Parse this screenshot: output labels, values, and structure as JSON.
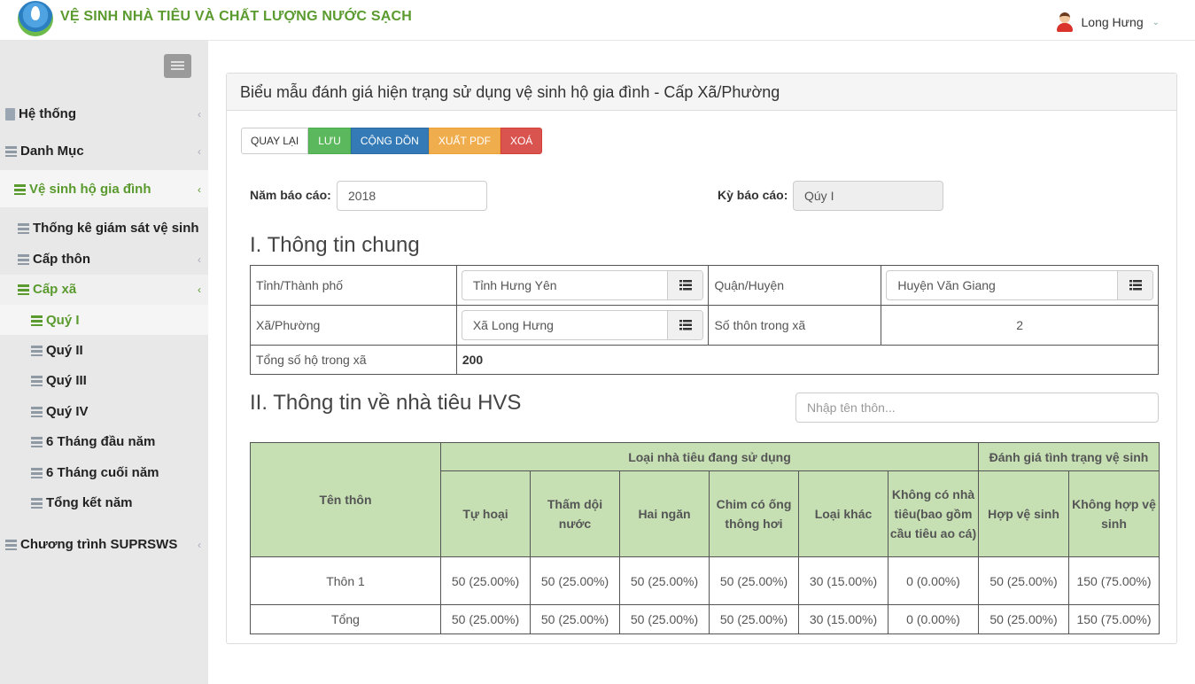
{
  "header": {
    "app_title": "VỆ SINH NHÀ TIÊU VÀ CHẤT LƯỢNG NƯỚC SẠCH",
    "user_name": "Long Hưng"
  },
  "sidebar": {
    "items": [
      {
        "label": "Hệ thống"
      },
      {
        "label": "Danh Mục"
      },
      {
        "label": "Vệ sinh hộ gia đình"
      },
      {
        "label": "Thống kê giám sát vệ sinh"
      },
      {
        "label": "Cấp thôn"
      },
      {
        "label": "Cấp xã"
      },
      {
        "label": "Quý I"
      },
      {
        "label": "Quý II"
      },
      {
        "label": "Quý III"
      },
      {
        "label": "Quý IV"
      },
      {
        "label": "6 Tháng đầu năm"
      },
      {
        "label": "6 Tháng cuối năm"
      },
      {
        "label": "Tổng kết năm"
      },
      {
        "label": "Chương trình SUPRSWS"
      }
    ]
  },
  "panel": {
    "title": "Biểu mẫu đánh giá hiện trạng sử dụng vệ sinh hộ gia đình - Cấp Xã/Phường",
    "buttons": {
      "back": "QUAY LẠI",
      "save": "LƯU",
      "accumulate": "CỘNG DỒN",
      "export_pdf": "XUẤT PDF",
      "delete": "XOÁ"
    },
    "year_label": "Năm báo cáo:",
    "year_value": "2018",
    "period_label": "Kỳ báo cáo:",
    "period_value": "Qúy I",
    "section1_title": "I. Thông tin chung",
    "info": {
      "province_label": "Tỉnh/Thành phố",
      "province_value": "Tỉnh Hưng Yên",
      "district_label": "Quận/Huyện",
      "district_value": "Huyện Văn Giang",
      "commune_label": "Xã/Phường",
      "commune_value": "Xã Long Hưng",
      "villages_label": "Số thôn trong xã",
      "villages_value": "2",
      "households_label": "Tổng số hộ trong xã",
      "households_value": "200"
    },
    "section2_title": "II. Thông tin về nhà tiêu HVS",
    "search_placeholder": "Nhập tên thôn...",
    "table": {
      "col_village": "Tên thôn",
      "group_types": "Loại nhà tiêu đang sử dụng",
      "group_eval": "Đánh giá tình trạng vệ sinh",
      "cols": [
        "Tự hoại",
        "Thấm dội nước",
        "Hai ngăn",
        "Chim có ống thông hơi",
        "Loại khác",
        "Không có nhà tiêu(bao gồm cầu tiêu ao cá)",
        "Hợp vệ sinh",
        "Không hợp vệ sinh"
      ],
      "rows": [
        {
          "name": "Thôn 1",
          "values": [
            "50 (25.00%)",
            "50 (25.00%)",
            "50 (25.00%)",
            "50 (25.00%)",
            "30 (15.00%)",
            "0 (0.00%)",
            "50 (25.00%)",
            "150 (75.00%)"
          ]
        },
        {
          "name": "Tổng",
          "values": [
            "50 (25.00%)",
            "50 (25.00%)",
            "50 (25.00%)",
            "50 (25.00%)",
            "30 (15.00%)",
            "0 (0.00%)",
            "50 (25.00%)",
            "150 (75.00%)"
          ]
        }
      ]
    }
  }
}
